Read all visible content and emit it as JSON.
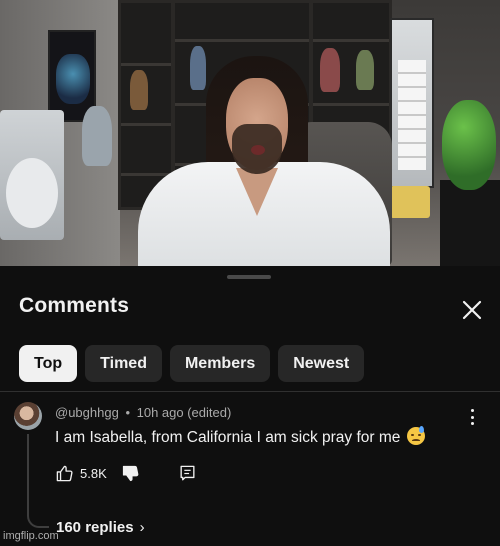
{
  "sheet": {
    "title": "Comments",
    "close_icon": "close-icon"
  },
  "tabs": [
    {
      "label": "Top",
      "active": true
    },
    {
      "label": "Timed",
      "active": false
    },
    {
      "label": "Members",
      "active": false
    },
    {
      "label": "Newest",
      "active": false
    }
  ],
  "comment": {
    "author": "@ubghhgg",
    "separator": "•",
    "time": "10h ago (edited)",
    "text": "I am Isabella, from California I am sick pray for me",
    "emoji": "sweat-face-emoji",
    "likes": "5.8K",
    "replies_label": "160 replies",
    "replies_chevron": "›"
  },
  "watermark": "imgflip.com",
  "colors": {
    "background": "#0f0f0f",
    "chip": "#272727",
    "chip_active": "#f1f1f1",
    "text": "#f1f1f1",
    "secondary_text": "#aaaaaa"
  }
}
